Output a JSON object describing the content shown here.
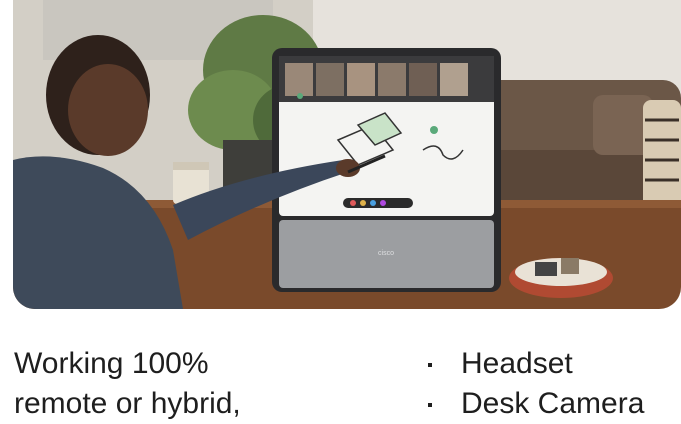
{
  "hero": {
    "image": "person-drawing-on-desk-video-device",
    "device_brand": "cisco"
  },
  "body_text": {
    "line1": "Working 100%",
    "line2": "remote or hybrid,"
  },
  "bullets": [
    {
      "label": "Headset"
    },
    {
      "label": "Desk Camera"
    }
  ],
  "colors": {
    "text": "#1e1e1e",
    "background": "#ffffff"
  }
}
